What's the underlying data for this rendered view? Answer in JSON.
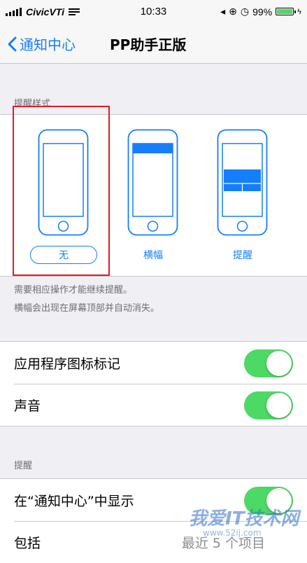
{
  "status_bar": {
    "carrier": "CivicVTi",
    "time": "10:33",
    "battery_percent": "99%",
    "battery_level": 0.99,
    "battery_color": "#4cd964"
  },
  "nav": {
    "back_label": "通知中心",
    "title": "PP助手正版",
    "accent_color": "#157efb"
  },
  "alert_style": {
    "section_header": "提醒样式",
    "options": [
      {
        "label": "无",
        "selected": true
      },
      {
        "label": "横幅",
        "selected": false
      },
      {
        "label": "提醒",
        "selected": false
      }
    ],
    "footer_line1": "需要相应操作才能继续提醒。",
    "footer_line2": "横幅会出现在屏幕顶部并自动消失。"
  },
  "settings_group1": {
    "rows": [
      {
        "label": "应用程序图标标记",
        "on": true
      },
      {
        "label": "声音",
        "on": true
      }
    ]
  },
  "alerts_group": {
    "section_header": "提醒",
    "rows": [
      {
        "label": "在“通知中心”中显示",
        "on": true
      },
      {
        "label": "包括",
        "value": "最近 5 个项目"
      }
    ]
  },
  "watermark": {
    "text": "我爱IT技术网",
    "url": "www.52ij.com"
  }
}
